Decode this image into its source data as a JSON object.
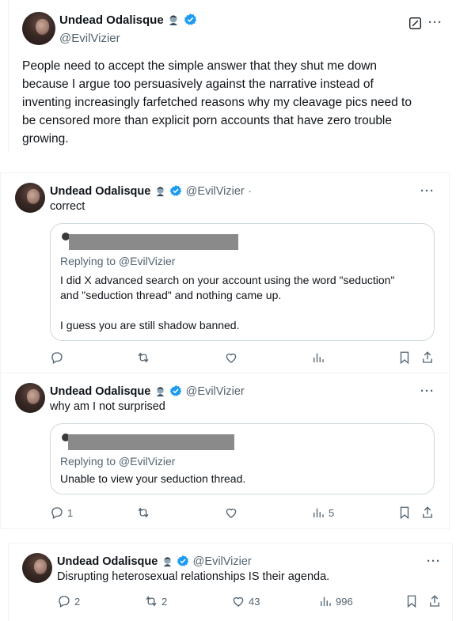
{
  "main_post": {
    "author_name": "Undead Odalisque",
    "handle": "@EvilVizier",
    "text_lines": [
      "People need to accept the simple answer that they shut me down",
      "because I argue too persuasively against the narrative instead of",
      "inventing increasingly farfetched reasons why my cleavage pics need to",
      "be censored more than explicit porn accounts that have zero trouble",
      "growing."
    ]
  },
  "replies": [
    {
      "author_name": "Undead Odalisque",
      "handle": "@EvilVizier",
      "separator": "·",
      "text": "correct",
      "quote": {
        "replying_to": "Replying to @EvilVizier",
        "lines": [
          "I did X advanced search on your account using the word \"seduction\"",
          "and \"seduction thread\" and nothing came up.",
          "",
          "I guess you are still shadow banned."
        ]
      },
      "counts": {
        "reply": "",
        "repost": "",
        "like": "",
        "views": ""
      }
    },
    {
      "author_name": "Undead Odalisque",
      "handle": "@EvilVizier",
      "text": "why am I not surprised",
      "quote": {
        "replying_to": "Replying to @EvilVizier",
        "lines": [
          "Unable to view your seduction thread."
        ]
      },
      "counts": {
        "reply": "1",
        "repost": "",
        "like": "",
        "views": "5"
      }
    },
    {
      "author_name": "Undead Odalisque",
      "handle": "@EvilVizier",
      "text": "Disrupting heterosexual relationships IS their agenda.",
      "counts": {
        "reply": "2",
        "repost": "2",
        "like": "43",
        "views": "996"
      }
    }
  ],
  "more_label": "···",
  "colors": {
    "verified": "#1d9bf0",
    "text": "#0f1419",
    "muted": "#536471",
    "border": "#cfd9de"
  }
}
